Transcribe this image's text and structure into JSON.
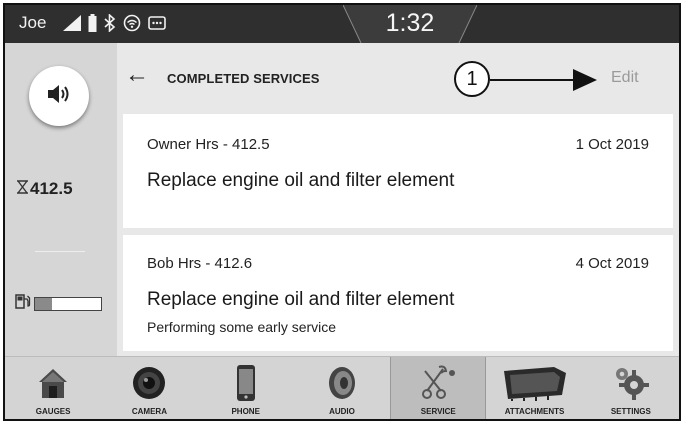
{
  "status_bar": {
    "user": "Joe",
    "clock": "1:32",
    "icons": [
      "signal-icon",
      "battery-icon",
      "bluetooth-icon",
      "wifi-icon",
      "message-icon"
    ]
  },
  "sidebar": {
    "volume_icon": "speaker-icon",
    "hours_icon": "hourglass-icon",
    "hours": "412.5",
    "fuel_icon": "fuel-pump-icon",
    "fuel_level": 0.25
  },
  "header": {
    "back_icon": "back-arrow-icon",
    "title": "COMPLETED SERVICES",
    "callout": "1",
    "edit_label": "Edit"
  },
  "services": [
    {
      "owner": "Owner Hrs - 412.5",
      "date": "1 Oct 2019",
      "task": "Replace engine oil and filter element",
      "note": ""
    },
    {
      "owner": "Bob Hrs - 412.6",
      "date": "4 Oct 2019",
      "task": "Replace engine oil and filter element",
      "note": "Performing some early service"
    }
  ],
  "bottom_nav": [
    {
      "label": "GAUGES",
      "icon": "house-icon",
      "active": false
    },
    {
      "label": "CAMERA",
      "icon": "camera-icon",
      "active": false
    },
    {
      "label": "PHONE",
      "icon": "phone-icon",
      "active": false
    },
    {
      "label": "AUDIO",
      "icon": "speaker-cone-icon",
      "active": false
    },
    {
      "label": "SERVICE",
      "icon": "wrench-icon",
      "active": true
    },
    {
      "label": "ATTACHMENTS",
      "icon": "bucket-icon",
      "active": false
    },
    {
      "label": "SETTINGS",
      "icon": "gear-icon",
      "active": false
    }
  ]
}
